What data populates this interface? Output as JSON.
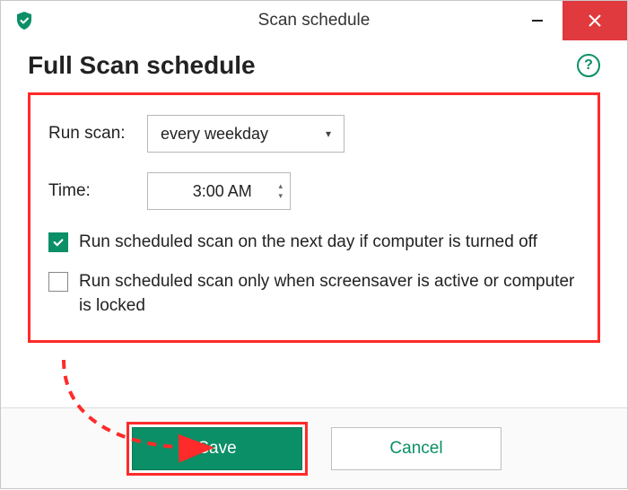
{
  "window": {
    "title": "Scan schedule"
  },
  "heading": "Full Scan schedule",
  "help_label": "?",
  "form": {
    "run_scan_label": "Run scan:",
    "run_scan_value": "every weekday",
    "time_label": "Time:",
    "time_value": "3:00 AM"
  },
  "options": {
    "next_day_if_off": {
      "label": "Run scheduled scan on the next day if computer is turned off",
      "checked": true
    },
    "only_screensaver": {
      "label": "Run scheduled scan only when screensaver is active or computer is locked",
      "checked": false
    }
  },
  "buttons": {
    "save": "Save",
    "cancel": "Cancel"
  },
  "colors": {
    "accent": "#0a8f66",
    "highlight": "#ff2a2a",
    "danger": "#e0393e"
  }
}
